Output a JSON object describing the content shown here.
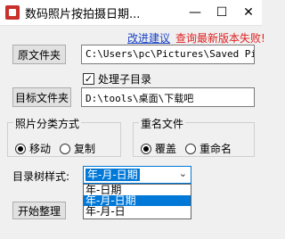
{
  "window": {
    "title": "数码照片按拍摄日期...",
    "min_glyph": "—",
    "max_glyph": "☐",
    "close_glyph": "✕"
  },
  "links": {
    "suggest": "改进建议",
    "update": "查询最新版本失败!"
  },
  "source": {
    "button": "原文件夹",
    "path": "C:\\Users\\pc\\Pictures\\Saved Pic"
  },
  "subdirs": {
    "label": "处理子目录",
    "checked": true
  },
  "target": {
    "button": "目标文件夹",
    "path": "D:\\tools\\桌面\\下载吧"
  },
  "classify": {
    "legend": "照片分类方式",
    "options": [
      {
        "label": "移动",
        "selected": true
      },
      {
        "label": "复制",
        "selected": false
      }
    ]
  },
  "rename": {
    "legend": "重名文件",
    "options": [
      {
        "label": "覆盖",
        "selected": true
      },
      {
        "label": "重命名",
        "selected": false
      }
    ]
  },
  "tree_style": {
    "label": "目录树样式:",
    "value": "年-月-日期",
    "options": [
      "年-日期",
      "年-月-日期",
      "年-月-日"
    ]
  },
  "start_button": "开始整理",
  "icons": {
    "app": "camera-icon",
    "check": "checkmark-icon",
    "dropdown": "chevron-down-icon"
  }
}
